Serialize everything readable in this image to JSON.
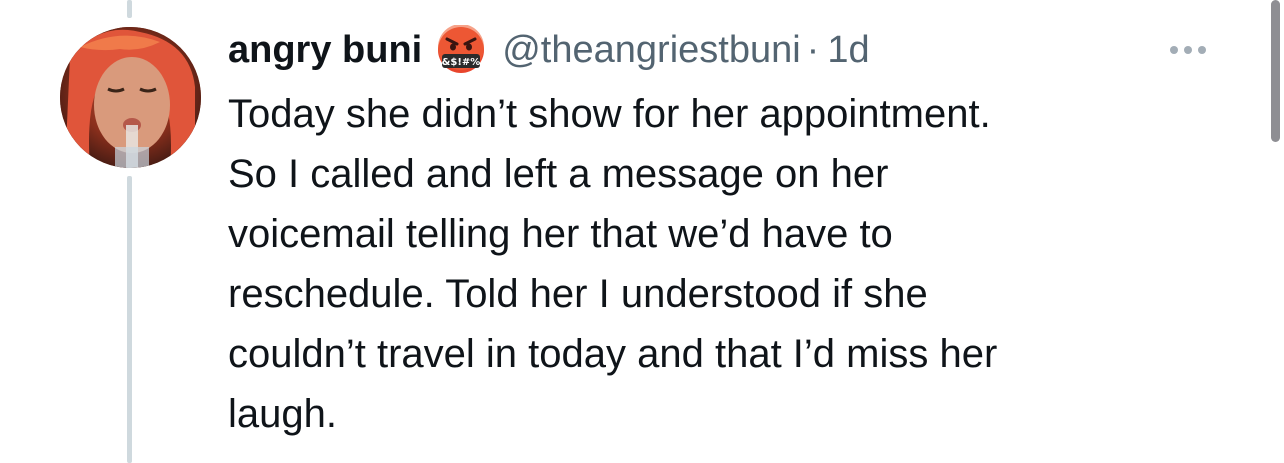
{
  "tweet": {
    "display_name": "angry buni",
    "badge_emoji_text": "&$!#%",
    "handle": "@theangriestbuni",
    "separator": "·",
    "time": "1d",
    "text_lines": [
      "Today she didn’t show for her appointment.",
      "So I called and left a message on her",
      "voicemail telling her that we’d have to",
      "reschedule. Told her I understood if she",
      "couldn’t travel in today and that I’d miss her",
      "laugh."
    ]
  },
  "icons": {
    "avatar": "profile-photo",
    "badge": "face-with-symbols-on-mouth-emoji",
    "more": "more-horizontal-icon"
  },
  "colors": {
    "text_primary": "#0f1419",
    "text_secondary": "#536471",
    "thread_line": "#cfd9de",
    "emoji_red": "#e8452c"
  }
}
